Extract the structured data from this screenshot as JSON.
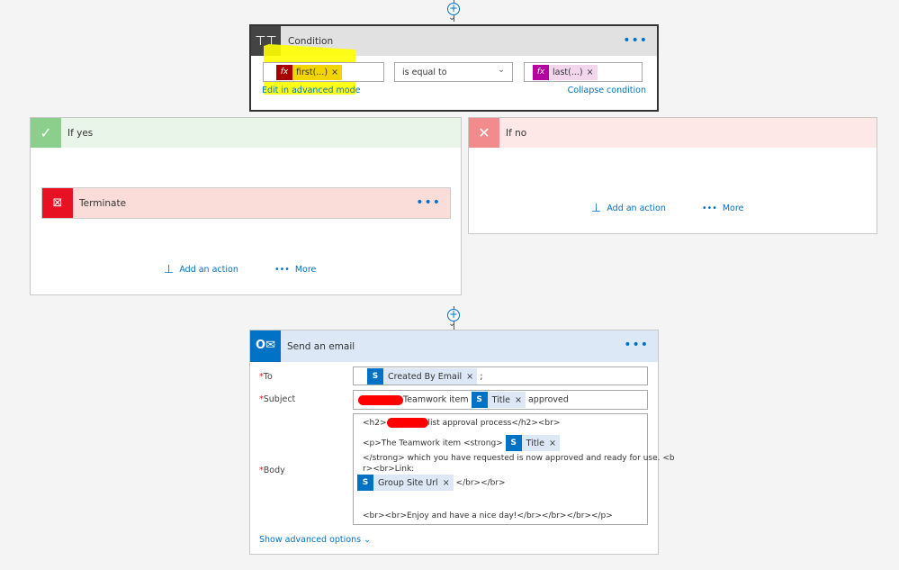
{
  "condition": {
    "title": "Condition",
    "more_icon": "ellipsis-icon",
    "left_operand": {
      "label": "first(...)",
      "icon": "fx-icon",
      "color": "#a80000"
    },
    "operator": "is equal to",
    "right_operand": {
      "label": "last(...)",
      "icon": "fx-icon",
      "color": "#b4009e"
    },
    "edit_advanced_link": "Edit in advanced mode",
    "collapse_link": "Collapse condition"
  },
  "if_yes": {
    "title": "If yes",
    "terminate": {
      "title": "Terminate"
    },
    "add_action": "Add an action",
    "more": "More"
  },
  "if_no": {
    "title": "If no",
    "add_action": "Add an action",
    "more": "More"
  },
  "email": {
    "title": "Send an email",
    "to": {
      "label": "To",
      "token": "Created By Email",
      "suffix": ";"
    },
    "subject": {
      "label": "Subject",
      "before": "Teamwork item",
      "token": "Title",
      "after": "approved"
    },
    "body": {
      "label": "Body",
      "line1": "list approval process</h2><br>",
      "line1_prefix": "<h2>",
      "line2": "<p>The Teamwork item <strong>",
      "line2_token": "Title",
      "line3": " </strong> which you have requested is now approved and ready for use. <b",
      "line4": "r><br>Link:",
      "line5_token": "Group Site Url",
      "line5_after": "</br></br>",
      "line6": "<br><br>Enjoy and have a nice day!</br></br></br></p>"
    },
    "show_advanced": "Show advanced options"
  },
  "colors": {
    "accent": "#0072c6",
    "yes": "#8ccf8c",
    "no": "#f28b8b",
    "terminate": "#e81123",
    "highlight": "#ffff00"
  }
}
